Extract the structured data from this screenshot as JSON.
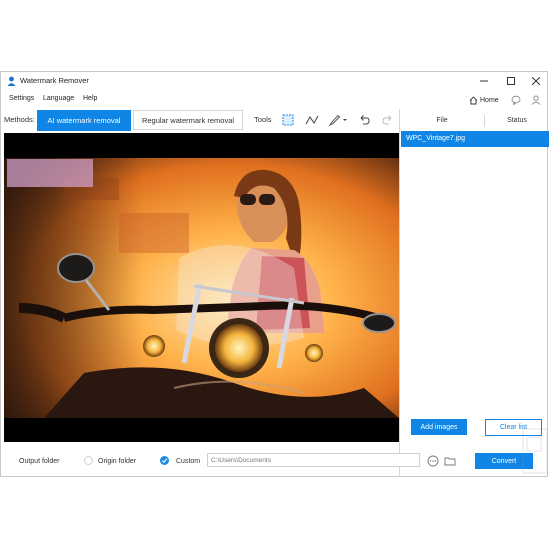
{
  "window": {
    "title": "Watermark Remover",
    "icon": "app-person-icon",
    "controls": [
      "minimize-icon",
      "maximize-icon",
      "close-icon"
    ]
  },
  "menu": {
    "items": [
      "Settings",
      "Language",
      "Help"
    ],
    "home_label": "Home"
  },
  "methods": {
    "label": "Methods:",
    "ai_tab": "AI watermark removal",
    "regular_tab": "Regular watermark removal",
    "tools_label": "Tools",
    "tools": [
      "rectangle-select-icon",
      "polyline-icon",
      "brush-icon",
      "undo-icon",
      "redo-icon"
    ]
  },
  "file_panel": {
    "col_file": "File",
    "col_status": "Status",
    "files": [
      {
        "name": "WPC_Vintage7.jpg",
        "selected": true
      }
    ],
    "add_button": "Add images",
    "clear_button": "Clear list"
  },
  "output": {
    "label": "Output folder",
    "option_origin": "Origin folder",
    "option_custom": "Custom",
    "selected": "Custom",
    "path_placeholder": "C:\\Users\\Documents",
    "convert_button": "Convert"
  },
  "colors": {
    "accent": "#0f86e6"
  }
}
